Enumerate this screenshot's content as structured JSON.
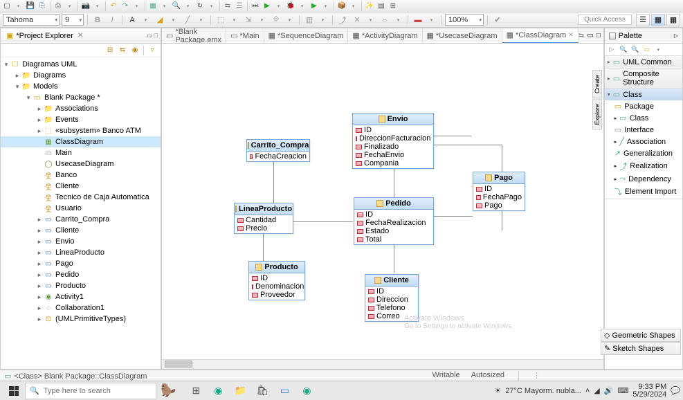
{
  "toolbar": {
    "font": "Tahoma",
    "size": "9",
    "zoom": "100%",
    "quick_access": "Quick Access"
  },
  "explorer": {
    "title": "*Project Explorer",
    "root": "Diagramas UML",
    "diagrams": "Diagrams",
    "models": "Models",
    "blank_pkg": "Blank Package *",
    "associations": "Associations",
    "events": "Events",
    "subsystem": "«subsystem» Banco ATM",
    "classdiagram": "ClassDiagram",
    "main": "Main",
    "usecase": "UsecaseDiagram",
    "banco": "Banco",
    "cliente": "Cliente",
    "tecnico": "Tecnico de Caja Automatica",
    "usuario": "Usuario",
    "carrito": "Carrito_Compra",
    "cliente2": "Cliente",
    "envio": "Envio",
    "lineaproducto": "LineaProducto",
    "pago": "Pago",
    "pedido": "Pedido",
    "producto": "Producto",
    "activity": "Activity1",
    "collab": "Collaboration1",
    "primtypes": "(UMLPrimitiveTypes)"
  },
  "tabs": {
    "blank_pkg": "*Blank Package.emx",
    "main": "*Main",
    "sequence": "*SequenceDiagram",
    "activity": "*ActivityDiagram",
    "usecase": "*UsecaseDiagram",
    "class": "*ClassDiagram"
  },
  "uml": {
    "envio": {
      "name": "Envio",
      "attrs": [
        "ID",
        "DireccionFacturacion",
        "Finalizado",
        "FechaEnvio",
        "Compania"
      ]
    },
    "carrito": {
      "name": "Carrito_Compra",
      "attrs": [
        "FechaCreacion"
      ]
    },
    "pago": {
      "name": "Pago",
      "attrs": [
        "ID",
        "FechaPago",
        "Pago"
      ]
    },
    "pedido": {
      "name": "Pedido",
      "attrs": [
        "ID",
        "FechaRealizacion",
        "Estado",
        "Total"
      ]
    },
    "linea": {
      "name": "LineaProducto",
      "attrs": [
        "Cantidad",
        "Precio"
      ]
    },
    "producto": {
      "name": "Producto",
      "attrs": [
        "ID",
        "Denominacion",
        "Proveedor"
      ]
    },
    "cliente": {
      "name": "Cliente",
      "attrs": [
        "ID",
        "Direccion",
        "Telefono",
        "Correo"
      ]
    }
  },
  "palette": {
    "title": "Palette",
    "uml_common": "UML Common",
    "composite": "Composite Structure",
    "class_sec": "Class",
    "package": "Package",
    "class_item": "Class",
    "interface": "Interface",
    "association": "Association",
    "generalization": "Generalization",
    "realization": "Realization",
    "dependency": "Dependency",
    "element_import": "Element Import",
    "geometric": "Geometric Shapes",
    "sketch": "Sketch Shapes",
    "sidetab_create": "Create",
    "sidetab_explore": "Explore"
  },
  "status": {
    "path": "<Class> Blank Package::ClassDiagram",
    "writable": "Writable",
    "autosized": "Autosized"
  },
  "watermark": {
    "title": "Activate Windows",
    "sub": "Go to Settings to activate Windows."
  },
  "taskbar": {
    "search_placeholder": "Type here to search",
    "weather": "27°C  Mayorm. nubla...",
    "time": "9:33 PM",
    "date": "5/29/2024"
  }
}
